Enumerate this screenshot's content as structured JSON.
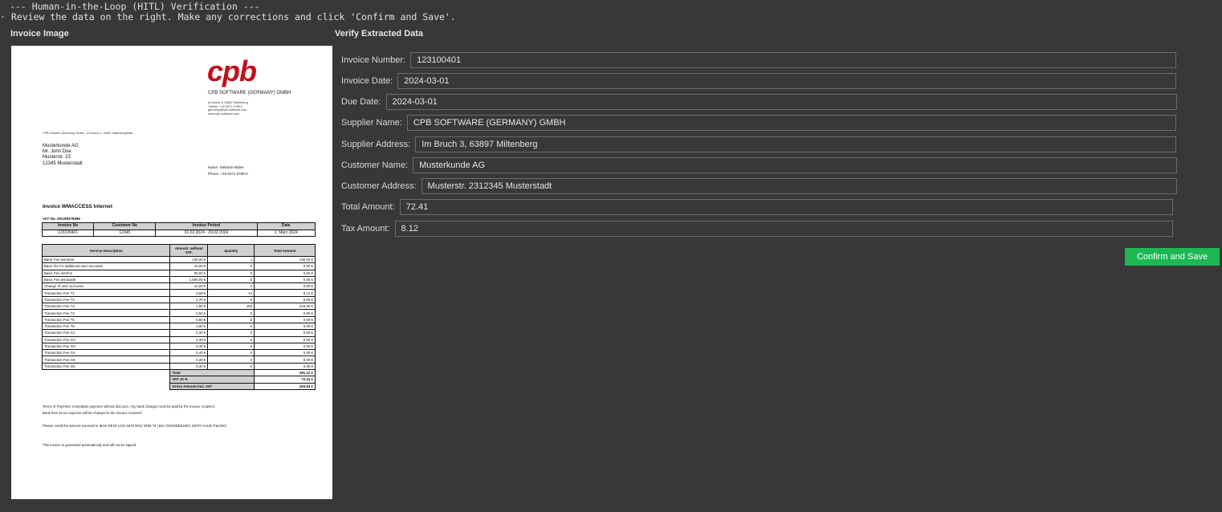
{
  "console": {
    "line1": "--- Human-in-the-Loop (HITL) Verification ---",
    "line2": "Review the data on the right. Make any corrections and click 'Confirm and Save'."
  },
  "left_title": "Invoice Image",
  "right_title": "Verify Extracted Data",
  "invoice": {
    "logo": "cpb",
    "company": "CPB SOFTWARE (GERMANY) GMBH",
    "company_address": [
      "Im Bruch 3, 63897 Miltenberg",
      "Telefon: +49 9371 9786-0",
      "germany@cpb-software.com",
      "www.cpb-software.com"
    ],
    "sender_line": "CPB Software (Germany) GmbH - Im Bruch 3 - 63897 Miltenberg/Main",
    "customer": [
      "Musterkunde AG",
      "Mr. John Doe",
      "Musterstr. 23",
      "12345 Musterstadt"
    ],
    "contact_name": "Name:  Stefanie Müller",
    "contact_phone": "Phone: +49 9371 9786-0",
    "title": "Invoice WMACCESS Internet",
    "vat_no": "VAT No. DE199378386",
    "header_table": {
      "columns": [
        "Invoice No",
        "Customer No",
        "Invoice Period",
        "Date"
      ],
      "values": [
        "123100401",
        "12345",
        "01.02.2024 - 29.02.2024",
        "1. März 2024"
      ]
    },
    "service_table": {
      "columns": [
        "Service Description",
        "Amount -without VAT-",
        "quantity",
        "Total Amount"
      ],
      "rows": [
        [
          "Basic Fee wmView",
          "130,00 €",
          "1",
          "130,00 €"
        ],
        [
          "Basic fee for additional user accounts",
          "10,00 €",
          "0",
          "0,00 €"
        ],
        [
          "Basic Fee wmPos",
          "50,00 €",
          "0",
          "0,00 €"
        ],
        [
          "Basic Fee wmGuide",
          "1.000,00 €",
          "0",
          "0,00 €"
        ],
        [
          "Change of user accounts",
          "10,00 €",
          "0",
          "0,00 €"
        ],
        [
          "Transaction Fee T1",
          "0,58 €",
          "14",
          "8,12 €"
        ],
        [
          "Transaction Fee T2",
          "0,70 €",
          "0",
          "0,00 €"
        ],
        [
          "Transaction Fee T3",
          "1,50 €",
          "162",
          "243,00 €"
        ],
        [
          "Transaction Fee T4",
          "0,50 €",
          "0",
          "0,00 €"
        ],
        [
          "Transaction Fee T5",
          "0,80 €",
          "0",
          "0,00 €"
        ],
        [
          "Transaction Fee T6",
          "1,80 €",
          "0",
          "0,00 €"
        ],
        [
          "Transaction Fee G1",
          "0,30 €",
          "0",
          "0,00 €"
        ],
        [
          "Transaction Fee G2",
          "0,30 €",
          "0",
          "0,00 €"
        ],
        [
          "Transaction Fee G3",
          "0,40 €",
          "0",
          "0,00 €"
        ],
        [
          "Transaction Fee G4",
          "0,40 €",
          "0",
          "0,00 €"
        ],
        [
          "Transaction Fee G5",
          "0,30 €",
          "0",
          "0,00 €"
        ],
        [
          "Transaction Fee G6",
          "0,30 €",
          "0",
          "0,00 €"
        ]
      ],
      "totals": [
        [
          "Total",
          "381,12 €"
        ],
        [
          "VAT 19 %",
          "72,41 €"
        ],
        [
          "Gross Amount incl. VAT",
          "453,53 €"
        ]
      ]
    },
    "terms_1": "Terms of Payment: Immediate payment without discount. Any bank charges must be paid by the invoice recipient.",
    "terms_2": "Bank fees at our expense will be charged to the invoice recipient!",
    "credit": "Please credit the amount invoiced to IBAN DE29 1234 5678 9012 3456 78 | BIC GENODE51MIC (SEPA Credit Transfer)",
    "signed": "This invoice is generated automatically and will not be signed"
  },
  "form": {
    "fields": [
      {
        "label": "Invoice Number:",
        "value": "123100401"
      },
      {
        "label": "Invoice Date:",
        "value": "2024-03-01"
      },
      {
        "label": "Due Date:",
        "value": "2024-03-01"
      },
      {
        "label": "Supplier Name:",
        "value": "CPB SOFTWARE (GERMANY) GMBH"
      },
      {
        "label": "Supplier Address:",
        "value": "Im Bruch 3, 63897 Miltenberg"
      },
      {
        "label": "Customer Name:",
        "value": "Musterkunde AG"
      },
      {
        "label": "Customer Address:",
        "value": "Musterstr. 2312345 Musterstadt"
      },
      {
        "label": "Total Amount:",
        "value": "72.41"
      },
      {
        "label": "Tax Amount:",
        "value": "8.12"
      }
    ],
    "confirm_label": "Confirm and Save"
  },
  "colors": {
    "background": "#383838",
    "logo_red": "#c40e1a",
    "confirm_green": "#1db854"
  }
}
